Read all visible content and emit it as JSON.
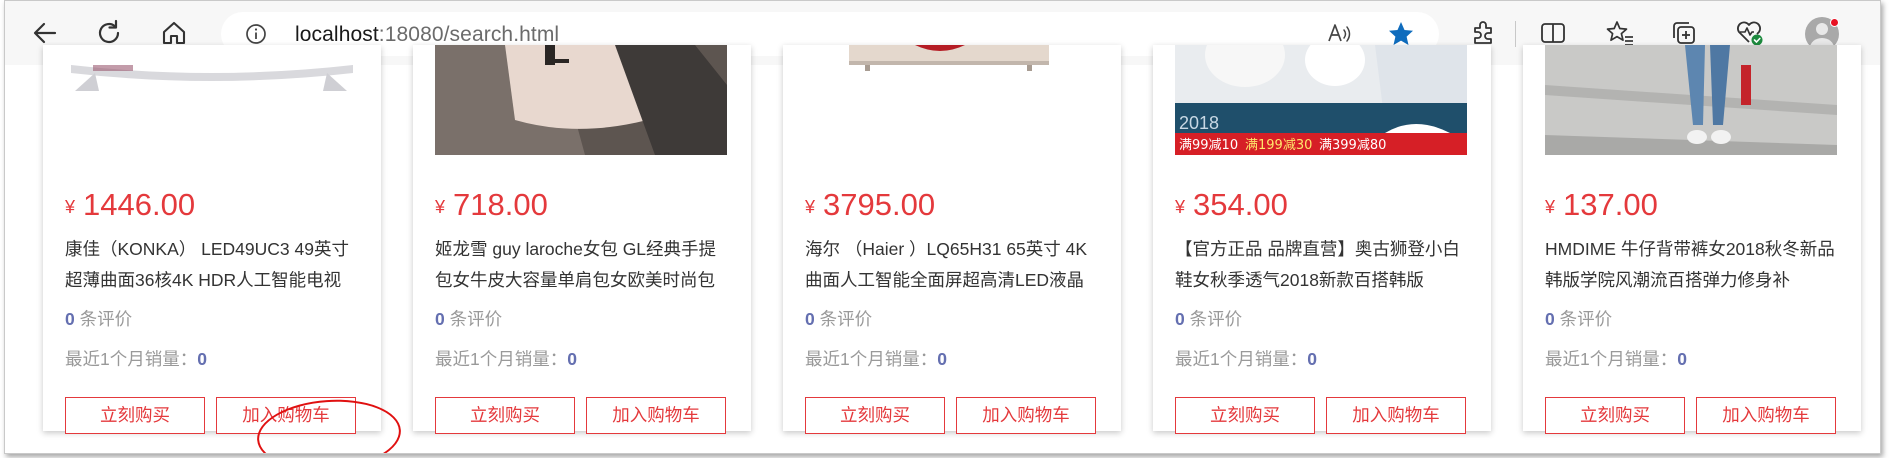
{
  "browser": {
    "url_host": "localhost",
    "url_rest": ":18080/search.html"
  },
  "products": [
    {
      "price": "1446.00",
      "title": "康佳（KONKA） LED49UC3 49英寸超薄曲面36核4K HDR人工智能电视",
      "reviews": "0",
      "reviews_label": "条评价",
      "sales_label": "最近1个月销量：",
      "sales": "0",
      "buy_label": "立刻购买",
      "cart_label": "加入购物车"
    },
    {
      "price": "718.00",
      "title": "姬龙雪 guy laroche女包 GL经典手提包女牛皮大容量单肩包女欧美时尚包",
      "reviews": "0",
      "reviews_label": "条评价",
      "sales_label": "最近1个月销量：",
      "sales": "0",
      "buy_label": "立刻购买",
      "cart_label": "加入购物车"
    },
    {
      "price": "3795.00",
      "title": "海尔 （Haier ）LQ65H31 65英寸 4K曲面人工智能全面屏超高清LED液晶",
      "reviews": "0",
      "reviews_label": "条评价",
      "sales_label": "最近1个月销量：",
      "sales": "0",
      "buy_label": "立刻购买",
      "cart_label": "加入购物车"
    },
    {
      "price": "354.00",
      "title": "【官方正品 品牌直营】奥古狮登小白鞋女秋季透气2018新款百搭韩版",
      "reviews": "0",
      "reviews_label": "条评价",
      "sales_label": "最近1个月销量：",
      "sales": "0",
      "buy_label": "立刻购买",
      "cart_label": "加入购物车"
    },
    {
      "price": "137.00",
      "title": "HMDIME 牛仔背带裤女2018秋冬新品 韩版学院风潮流百搭弹力修身补",
      "reviews": "0",
      "reviews_label": "条评价",
      "sales_label": "最近1个月销量：",
      "sales": "0",
      "buy_label": "立刻购买",
      "cart_label": "加入购物车"
    }
  ],
  "promo_banner": {
    "year": "2018",
    "deals": [
      "满99减10",
      "满199减30",
      "满399减80"
    ]
  },
  "currency_symbol": "¥",
  "colors": {
    "price": "#e4393c",
    "accent_blue": "#0f6cbd",
    "count": "#646fb0",
    "annotation_circle": "#e01010"
  },
  "icons": [
    "back-arrow-icon",
    "refresh-icon",
    "home-icon",
    "site-info-icon",
    "read-aloud-icon",
    "favorite-star-icon",
    "extensions-icon",
    "split-screen-icon",
    "favorites-icon",
    "collections-icon",
    "browser-essentials-icon",
    "profile-avatar"
  ]
}
